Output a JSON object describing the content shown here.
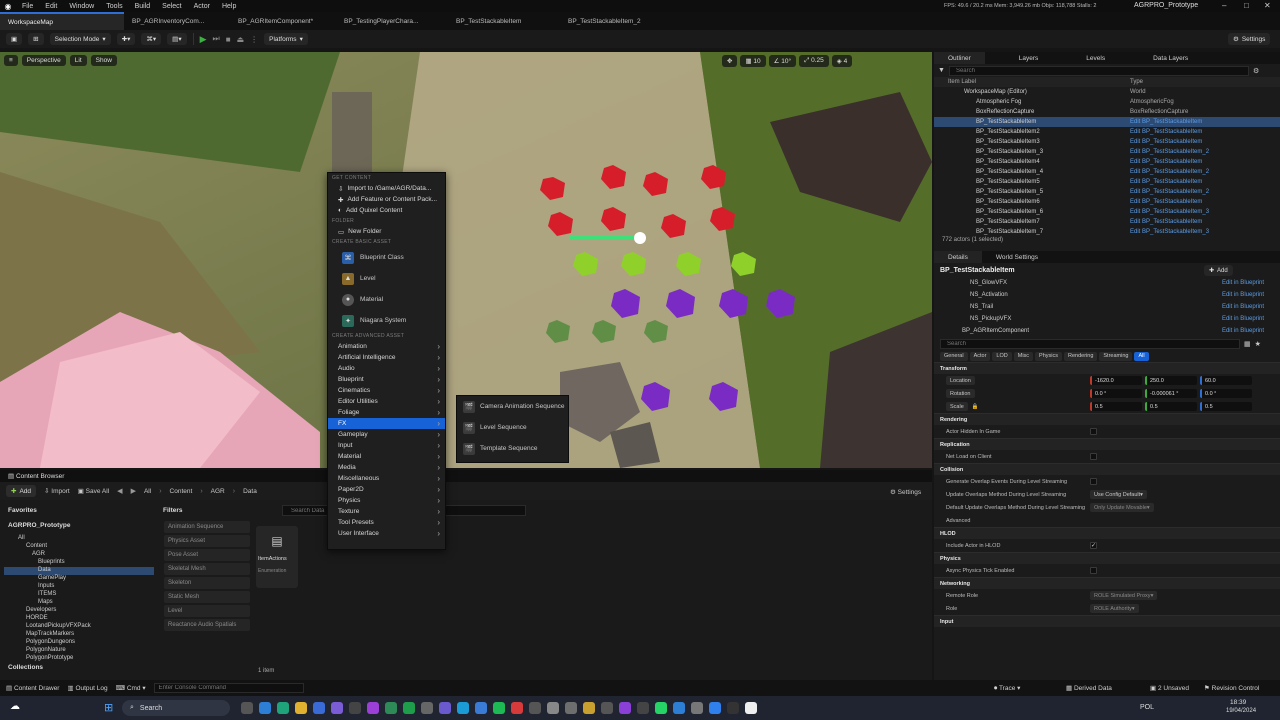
{
  "menu": [
    "File",
    "Edit",
    "Window",
    "Tools",
    "Build",
    "Select",
    "Actor",
    "Help"
  ],
  "tabs": [
    {
      "label": "WorkspaceMap"
    },
    {
      "label": "BP_AGRInventoryCom..."
    },
    {
      "label": "BP_AGRItemComponent*"
    },
    {
      "label": "BP_TestingPlayerChara..."
    },
    {
      "label": "BP_TestStackableItem"
    },
    {
      "label": "BP_TestStackableItem_2"
    }
  ],
  "stats": "FPS: 49.6  / 20.2 ms  Mem: 3,949.26 mb  Objs: 118,788  Stalls: 2",
  "project": "AGRPRO_Prototype",
  "toolbar": {
    "selection_mode": "Selection Mode",
    "platforms": "Platforms",
    "settings": "Settings"
  },
  "viewport": {
    "perspective": "Perspective",
    "lit": "Lit",
    "show": "Show",
    "snap": "10",
    "angle": "10°",
    "scale": "0.25",
    "cam": "4"
  },
  "ctx": {
    "hdr_get": "GET CONTENT",
    "import": "Import to /Game/AGR/Data...",
    "add_feature": "Add Feature or Content Pack...",
    "add_quixel": "Add Quixel Content",
    "hdr_folder": "FOLDER",
    "new_folder": "New Folder",
    "hdr_basic": "CREATE BASIC ASSET",
    "blueprint_class": "Blueprint Class",
    "level": "Level",
    "material": "Material",
    "niagara": "Niagara System",
    "hdr_adv": "CREATE ADVANCED ASSET",
    "adv": [
      "Animation",
      "Artificial Intelligence",
      "Audio",
      "Blueprint",
      "Cinematics",
      "Editor Utilities",
      "Foliage",
      "FX",
      "Gameplay",
      "Input",
      "Material",
      "Media",
      "Miscellaneous",
      "Paper2D",
      "Physics",
      "Texture",
      "Tool Presets",
      "User Interface"
    ]
  },
  "fx_sub": [
    "Camera Animation Sequence",
    "Level Sequence",
    "Template Sequence"
  ],
  "cb": {
    "tab": "Content Browser",
    "add": "Add",
    "import": "Import",
    "save_all": "Save All",
    "path": [
      "All",
      "Content",
      "AGR",
      "Data"
    ],
    "settings": "Settings",
    "favorites": "Favorites",
    "project": "AGRPRO_Prototype",
    "filters": "Filters",
    "search_placeholder": "Search Data",
    "item": "ItemActions",
    "item_sub": "Enumeration",
    "count": "1 item",
    "collections": "Collections",
    "tree": [
      "All",
      "Content",
      "AGR",
      "Blueprints",
      "Data",
      "GamePlay",
      "Inputs",
      "ITEMS",
      "Maps",
      "Developers",
      "HORDE",
      "LootandPickupVFXPack",
      "MapTrackMarkers",
      "PolygonDungeons",
      "PolygonNature",
      "PolygonPrototype"
    ],
    "filter_items": [
      "Animation Sequence",
      "Physics Asset",
      "Pose Asset",
      "Skeletal Mesh",
      "Skeleton",
      "Static Mesh",
      "Level",
      "Reactance Audio Spatials"
    ]
  },
  "outliner": {
    "tabs": [
      "Outliner",
      "Layers",
      "Levels",
      "Data Layers"
    ],
    "search": "Search",
    "col_label": "Item Label",
    "col_type": "Type",
    "count": "772 actors (1 selected)",
    "rows": [
      {
        "n": "WorkspaceMap (Editor)",
        "t": "World"
      },
      {
        "n": "Atmospheric Fog",
        "t": "AtmosphericFog"
      },
      {
        "n": "BoxReflectionCapture",
        "t": "BoxReflectionCapture"
      },
      {
        "n": "BP_TestStackableItem",
        "t": "Edit BP_TestStackableItem"
      },
      {
        "n": "BP_TestStackableItem2",
        "t": "Edit BP_TestStackableItem"
      },
      {
        "n": "BP_TestStackableItem3",
        "t": "Edit BP_TestStackableItem"
      },
      {
        "n": "BP_TestStackableItem_3",
        "t": "Edit BP_TestStackableItem_2"
      },
      {
        "n": "BP_TestStackableItem4",
        "t": "Edit BP_TestStackableItem"
      },
      {
        "n": "BP_TestStackableItem_4",
        "t": "Edit BP_TestStackableItem_2"
      },
      {
        "n": "BP_TestStackableItem5",
        "t": "Edit BP_TestStackableItem"
      },
      {
        "n": "BP_TestStackableItem_5",
        "t": "Edit BP_TestStackableItem_2"
      },
      {
        "n": "BP_TestStackableItem6",
        "t": "Edit BP_TestStackableItem"
      },
      {
        "n": "BP_TestStackableItem_6",
        "t": "Edit BP_TestStackableItem_3"
      },
      {
        "n": "BP_TestStackableItem7",
        "t": "Edit BP_TestStackableItem"
      },
      {
        "n": "BP_TestStackableItem_7",
        "t": "Edit BP_TestStackableItem_3"
      }
    ]
  },
  "details": {
    "tabs": [
      "Details",
      "World Settings"
    ],
    "title": "BP_TestStackableItem",
    "add": "Add",
    "comps": [
      "NS_GlowVFX",
      "NS_Activation",
      "NS_Trail",
      "NS_PickupVFX",
      "BP_AGRItemComponent"
    ],
    "edit_bp": "Edit in Blueprint",
    "search": "Search",
    "cats": [
      "General",
      "Actor",
      "LOD",
      "Misc",
      "Physics",
      "Rendering",
      "Streaming",
      "All"
    ],
    "transform": "Transform",
    "location": "Location",
    "rotation": "Rotation",
    "scale": "Scale",
    "loc": [
      "-1620.0",
      "250.0",
      "60.0"
    ],
    "rot": [
      "0.0 °",
      "-0.000061 °",
      "0.0 °"
    ],
    "scl": [
      "0.5",
      "0.5",
      "0.5"
    ],
    "rendering": "Rendering",
    "hidden": "Actor Hidden In Game",
    "replication": "Replication",
    "netload": "Net Load on Client",
    "collision": "Collision",
    "gen_overlap": "Generate Overlap Events During Level Streaming",
    "upd_overlap": "Update Overlaps Method During Level Streaming",
    "upd_val": "Use Config Default",
    "def_overlap": "Default Update Overlaps Method During Level Streaming",
    "def_val": "Only Update Movable",
    "advanced": "Advanced",
    "hlod": "HLOD",
    "incl_hlod": "Include Actor in HLOD",
    "physics": "Physics",
    "async": "Async Physics Tick Enabled",
    "networking": "Networking",
    "remote_role": "Remote Role",
    "remote_val": "ROLE Simulated Proxy",
    "role": "Role",
    "role_val": "ROLE Authority",
    "input": "Input"
  },
  "status": {
    "drawer": "Content Drawer",
    "output": "Output Log",
    "cmd": "Cmd",
    "console": "Enter Console Command",
    "trace": "Trace",
    "derived": "Derived Data",
    "unsaved": "2 Unsaved",
    "revision": "Revision Control"
  },
  "taskbar": {
    "search": "Search",
    "lang": "POL",
    "time": "18:39",
    "date": "19/04/2024"
  }
}
